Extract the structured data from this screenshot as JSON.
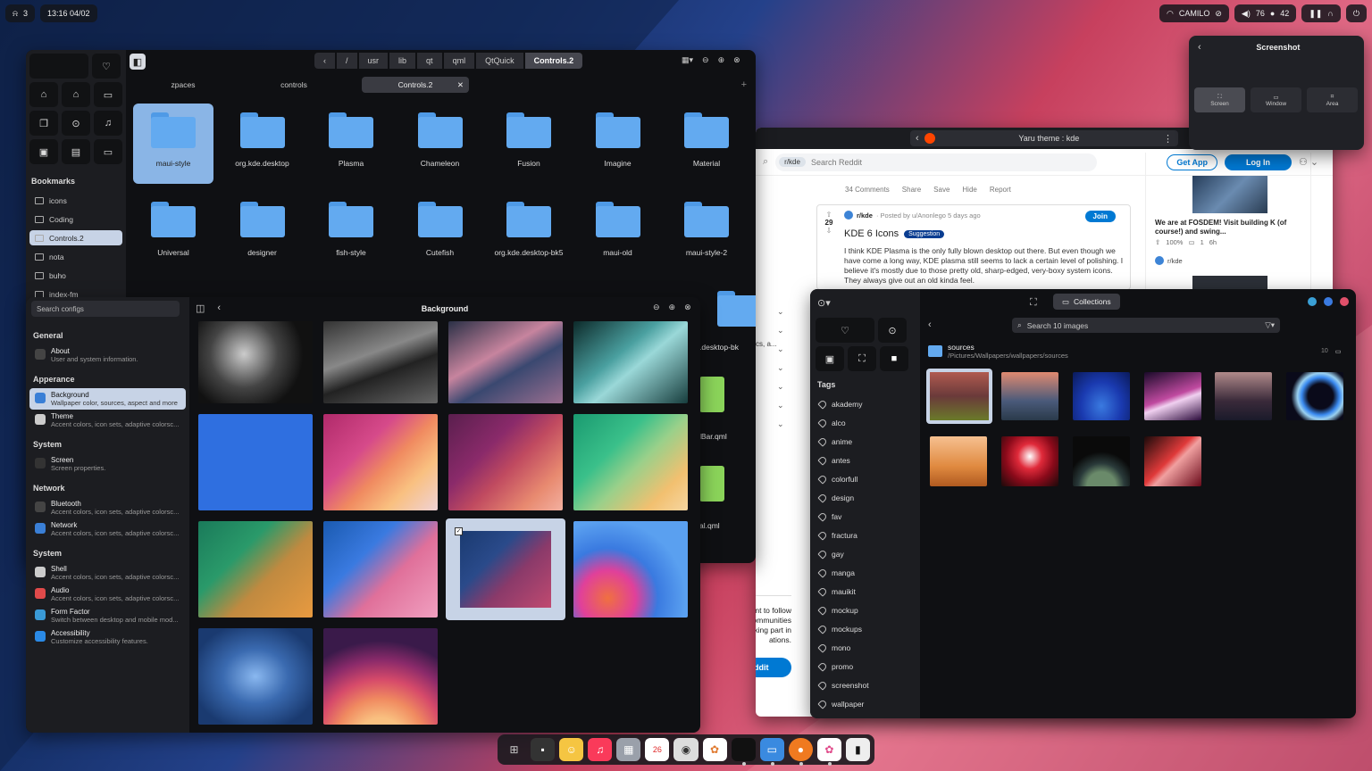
{
  "topbar": {
    "workspace": "3",
    "datetime": "13:16 04/02",
    "network": "CAMILO",
    "volume": "76",
    "mic": "42"
  },
  "fm": {
    "breadcrumbs": [
      "/",
      "usr",
      "lib",
      "qt",
      "qml",
      "QtQuick",
      "Controls.2"
    ],
    "tabs": [
      "zpaces",
      "controls",
      "Controls.2"
    ],
    "bookmarks_title": "Bookmarks",
    "bookmarks": [
      "icons",
      "Coding",
      "Controls.2",
      "nota",
      "buho",
      "index-fm"
    ],
    "folders": [
      "maui-style",
      "org.kde.desktop",
      "Plasma",
      "Chameleon",
      "Fusion",
      "Imagine",
      "Material",
      "Universal",
      "designer",
      "fish-style",
      "Cutefish",
      "org.kde.desktop-bk5",
      "maui-old",
      "maui-style-2"
    ],
    "partial_labels": [
      ".desktop-bk",
      "lBar.qml",
      "al.qml"
    ]
  },
  "settings": {
    "search_placeholder": "Search configs",
    "title": "Background",
    "sections": [
      {
        "name": "General",
        "items": [
          {
            "t": "About",
            "s": "User and system information.",
            "c": "#444"
          }
        ]
      },
      {
        "name": "Apperance",
        "items": [
          {
            "t": "Background",
            "s": "Wallpaper color, sources, aspect and more",
            "c": "#3a7fd6",
            "sel": true
          },
          {
            "t": "Theme",
            "s": "Accent colors, icon sets, adaptive colorsc...",
            "c": "#ccc"
          }
        ]
      },
      {
        "name": "System",
        "items": [
          {
            "t": "Screen",
            "s": "Screen properties.",
            "c": "#333"
          }
        ]
      },
      {
        "name": "Network",
        "items": [
          {
            "t": "Bluetooth",
            "s": "Accent colors, icon sets, adaptive colorsc...",
            "c": "#444"
          },
          {
            "t": "Network",
            "s": "Accent colors, icon sets, adaptive colorsc...",
            "c": "#3a7fd6"
          }
        ]
      },
      {
        "name": "System",
        "items": [
          {
            "t": "Shell",
            "s": "Accent colors, icon sets, adaptive colorsc...",
            "c": "#ccc"
          },
          {
            "t": "Audio",
            "s": "Accent colors, icon sets, adaptive colorsc...",
            "c": "#e04a4a"
          },
          {
            "t": "Form Factor",
            "s": "Switch between desktop and mobile mod...",
            "c": "#3a9ad6"
          },
          {
            "t": "Accessibility",
            "s": "Customize accessibility features.",
            "c": "#2a8ae6"
          }
        ]
      }
    ]
  },
  "reddit": {
    "url": "Yaru theme : kde",
    "search_chip": "r/kde",
    "search_placeholder": "Search Reddit",
    "get_app": "Get App",
    "login": "Log In",
    "actions": [
      "34 Comments",
      "Share",
      "Save",
      "Hide",
      "Report"
    ],
    "post": {
      "sub": "r/kde",
      "meta": "· Posted by u/Anonlego 5 days ago",
      "join": "Join",
      "votes": "29",
      "title": "KDE 6 Icons",
      "flair": "Suggestion",
      "body": "I think KDE Plasma is the only fully blown desktop out there. But even though we have come a long way, KDE plasma still seems to lack a certain level of polishing. I believe it's mostly due to those pretty old, sharp-edged, very-boxy system icons. They always give out an old kinda feel."
    },
    "side": {
      "title": "We are at FOSDEM! Visit building K (of course!) and swing...",
      "pct": "100%",
      "comments": "1",
      "time": "6h",
      "sub": "r/kde"
    },
    "signup_text": "n account to follow\norite communities\nrt taking part in\nations.",
    "join_reddit": "Join Reddit",
    "partial": "cs, a..."
  },
  "screenshot": {
    "title": "Screenshot",
    "opts": [
      "Screen",
      "Window",
      "Area"
    ]
  },
  "gallery": {
    "tab": "Collections",
    "search_placeholder": "Search 10 images",
    "tags_title": "Tags",
    "tags": [
      "akademy",
      "alco",
      "anime",
      "antes",
      "colorfull",
      "design",
      "fav",
      "fractura",
      "gay",
      "manga",
      "mauikit",
      "mockup",
      "mockups",
      "mono",
      "promo",
      "screenshot",
      "wallpaper"
    ],
    "folder": {
      "name": "sources",
      "path": "/Pictures/Wallpapers/wallpapers/sources",
      "count": "10"
    }
  },
  "dock": {
    "calendar": "26"
  }
}
